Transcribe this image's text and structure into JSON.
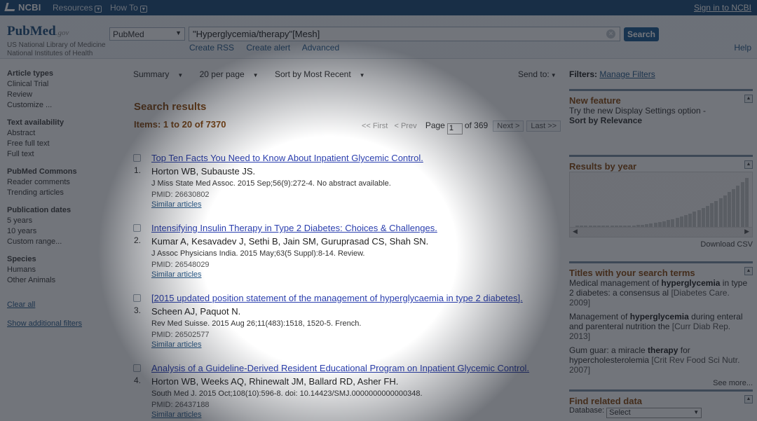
{
  "topbar": {
    "logo": "NCBI",
    "resources": "Resources",
    "howto": "How To",
    "signin": "Sign in to NCBI"
  },
  "header": {
    "logo_main": "PubMed",
    "logo_gov": ".gov",
    "nlm": "US National Library of Medicine National Institutes of Health",
    "database": "PubMed",
    "query": "\"Hyperglycemia/therapy\"[Mesh]",
    "search_button": "Search",
    "links": [
      "Create RSS",
      "Create alert",
      "Advanced"
    ],
    "help": "Help"
  },
  "sidebar": {
    "sections": [
      {
        "title": "Article types",
        "items": [
          "Clinical Trial",
          "Review",
          "Customize ..."
        ]
      },
      {
        "title": "Text availability",
        "items": [
          "Abstract",
          "Free full text",
          "Full text"
        ]
      },
      {
        "title": "PubMed Commons",
        "items": [
          "Reader comments",
          "Trending articles"
        ]
      },
      {
        "title": "Publication dates",
        "items": [
          "5 years",
          "10 years",
          "Custom range..."
        ]
      },
      {
        "title": "Species",
        "items": [
          "Humans",
          "Other Animals"
        ]
      }
    ],
    "clear_all": "Clear all",
    "show_filters": "Show additional filters"
  },
  "toolbar": {
    "summary": "Summary",
    "per_page": "20 per page",
    "sort": "Sort by Most Recent",
    "send_to": "Send to:"
  },
  "results": {
    "heading": "Search results",
    "count": "Items: 1 to 20 of 7370",
    "pager": {
      "first": "<< First",
      "prev": "< Prev",
      "page_label": "Page",
      "page_value": "1",
      "of": "of 369",
      "next": "Next >",
      "last": "Last >>"
    },
    "items": [
      {
        "num": "1.",
        "title": "Top Ten Facts You Need to Know About Inpatient Glycemic Control.",
        "authors": "Horton WB, Subauste JS.",
        "journal": "J Miss State Med Assoc. 2015 Sep;56(9):272-4. No abstract available.",
        "pmid": "PMID: 26630802",
        "similar": "Similar articles"
      },
      {
        "num": "2.",
        "title": "Intensifying Insulin Therapy in Type 2 Diabetes: Choices & Challenges.",
        "authors": "Kumar A, Kesavadev J, Sethi B, Jain SM, Guruprasad CS, Shah SN.",
        "journal": "J Assoc Physicians India. 2015 May;63(5 Suppl):8-14. Review.",
        "pmid": "PMID: 26548029",
        "similar": "Similar articles"
      },
      {
        "num": "3.",
        "title": "[2015 updated position statement of the management of hyperglycaemia in type 2 diabetes].",
        "authors": "Scheen AJ, Paquot N.",
        "journal": "Rev Med Suisse. 2015 Aug 26;11(483):1518, 1520-5. French.",
        "pmid": "PMID: 26502577",
        "similar": "Similar articles"
      },
      {
        "num": "4.",
        "title": "Analysis of a Guideline-Derived Resident Educational Program on Inpatient Glycemic Control.",
        "authors": "Horton WB, Weeks AQ, Rhinewalt JM, Ballard RD, Asher FH.",
        "journal": "South Med J. 2015 Oct;108(10):596-8. doi: 10.14423/SMJ.0000000000000348.",
        "pmid": "PMID: 26437188",
        "similar": "Similar articles"
      }
    ]
  },
  "right": {
    "filters_label": "Filters:",
    "manage_filters": "Manage Filters",
    "new_feature": {
      "title": "New feature",
      "text": "Try the new Display Settings option -",
      "bold": "Sort by Relevance"
    },
    "results_by_year": {
      "title": "Results by year",
      "download": "Download CSV"
    },
    "titles_with_terms": {
      "title": "Titles with your search terms",
      "items": [
        {
          "pre": "Medical management of ",
          "bold": "hyperglycemia",
          "post": " in type 2 diabetes: a consensus al",
          "src": " [Diabetes Care. 2009]"
        },
        {
          "pre": "Management of ",
          "bold": "hyperglycemia",
          "post": " during enteral and parenteral nutrition the",
          "src": " [Curr Diab Rep. 2013]"
        },
        {
          "pre": "Gum guar: a miracle ",
          "bold": "therapy",
          "post": " for hypercholesterolemia",
          "src": " [Crit Rev Food Sci Nutr. 2007]"
        }
      ],
      "see_more": "See more..."
    },
    "related": {
      "title": "Find related data",
      "db_label": "Database:",
      "db_value": "Select"
    }
  },
  "colors": {
    "nav": "#1e4d7a",
    "link": "#2a3eae",
    "heading": "#8a4a10"
  }
}
